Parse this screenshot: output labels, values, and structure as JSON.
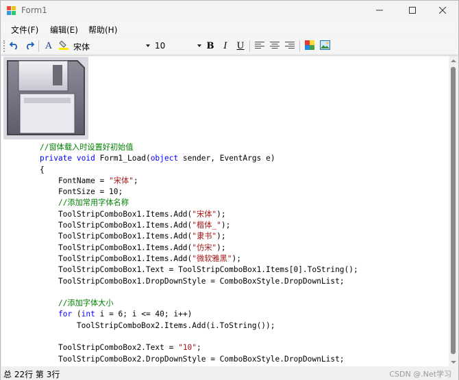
{
  "window": {
    "title": "Form1",
    "icon": "winforms-app-icon"
  },
  "title_buttons": {
    "minimize": "minimize-icon",
    "maximize": "maximize-icon",
    "close": "close-icon"
  },
  "menu": {
    "file": "文件(F)",
    "edit": "编辑(E)",
    "help": "帮助(H)"
  },
  "toolbar": {
    "undo_icon": "undo-icon",
    "redo_icon": "redo-icon",
    "font_color_label": "A",
    "highlight_icon": "highlight-icon",
    "font_name": "宋体",
    "font_size": "10",
    "bold": "B",
    "italic": "I",
    "underline": "U",
    "align_left_icon": "align-left-icon",
    "align_center_icon": "align-center-icon",
    "align_right_icon": "align-right-icon",
    "color_icon": "color-palette-icon",
    "image_icon": "insert-image-icon"
  },
  "editor": {
    "image_icon": "floppy-disk-icon",
    "code_lines": [
      [
        {
          "t": "//窗体载入时设置好初始值",
          "c": "cm"
        }
      ],
      [
        {
          "t": "private",
          "c": "kw"
        },
        {
          "t": " "
        },
        {
          "t": "void",
          "c": "kw"
        },
        {
          "t": " Form1_Load("
        },
        {
          "t": "object",
          "c": "kw"
        },
        {
          "t": " sender, EventArgs e)"
        }
      ],
      [
        {
          "t": "{"
        }
      ],
      [
        {
          "t": "    FontName = "
        },
        {
          "t": "\"宋体\"",
          "c": "st"
        },
        {
          "t": ";"
        }
      ],
      [
        {
          "t": "    FontSize = 10;"
        }
      ],
      [
        {
          "t": "    "
        },
        {
          "t": "//添加常用字体名称",
          "c": "cm"
        }
      ],
      [
        {
          "t": "    ToolStripComboBox1.Items.Add("
        },
        {
          "t": "\"宋体\"",
          "c": "st"
        },
        {
          "t": ");"
        }
      ],
      [
        {
          "t": "    ToolStripComboBox1.Items.Add("
        },
        {
          "t": "\"楷体_\"",
          "c": "st"
        },
        {
          "t": ");"
        }
      ],
      [
        {
          "t": "    ToolStripComboBox1.Items.Add("
        },
        {
          "t": "\"隶书\"",
          "c": "st"
        },
        {
          "t": ");"
        }
      ],
      [
        {
          "t": "    ToolStripComboBox1.Items.Add("
        },
        {
          "t": "\"仿宋\"",
          "c": "st"
        },
        {
          "t": ");"
        }
      ],
      [
        {
          "t": "    ToolStripComboBox1.Items.Add("
        },
        {
          "t": "\"微软雅黑\"",
          "c": "st"
        },
        {
          "t": ");"
        }
      ],
      [
        {
          "t": "    ToolStripComboBox1.Text = ToolStripComboBox1.Items[0].ToString();"
        }
      ],
      [
        {
          "t": "    ToolStripComboBox1.DropDownStyle = ComboBoxStyle.DropDownList;"
        }
      ],
      [
        {
          "t": ""
        }
      ],
      [
        {
          "t": "    "
        },
        {
          "t": "//添加字体大小",
          "c": "cm"
        }
      ],
      [
        {
          "t": "    "
        },
        {
          "t": "for",
          "c": "kw"
        },
        {
          "t": " ("
        },
        {
          "t": "int",
          "c": "kw"
        },
        {
          "t": " i = 6; i <= 40; i++)"
        }
      ],
      [
        {
          "t": "        ToolStripComboBox2.Items.Add(i.ToString());"
        }
      ],
      [
        {
          "t": ""
        }
      ],
      [
        {
          "t": "    ToolStripComboBox2.Text = "
        },
        {
          "t": "\"10\"",
          "c": "st"
        },
        {
          "t": ";"
        }
      ],
      [
        {
          "t": "    ToolStripComboBox2.DropDownStyle = ComboBoxStyle.DropDownList;"
        }
      ]
    ]
  },
  "status": {
    "text": "总 22行 第 3行"
  },
  "watermark": "CSDN @.Net学习"
}
